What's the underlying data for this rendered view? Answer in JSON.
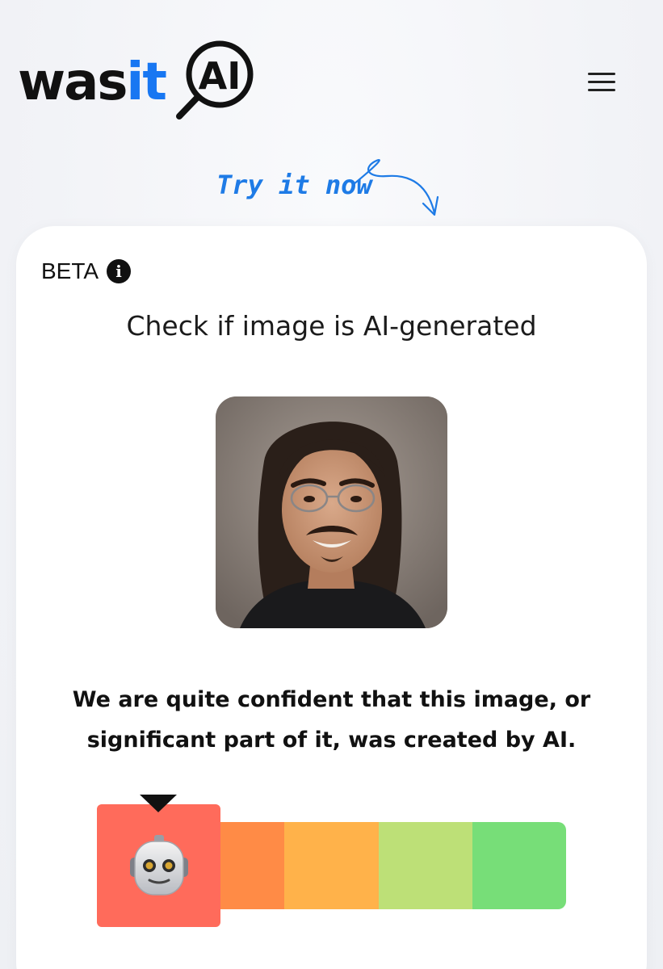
{
  "header": {
    "logo": {
      "text_main": "wasit",
      "text_accent": "AI"
    },
    "menu_icon": "hamburger-menu-icon"
  },
  "cta": {
    "try_now": "Try it now"
  },
  "card": {
    "beta_label": "BETA",
    "info_icon": "info-icon",
    "title": "Check if image is AI-generated",
    "photo_alt": "Uploaded portrait photo",
    "verdict_line1": "We are quite confident that this image, or",
    "verdict_line2": "significant part of it, was created by AI.",
    "meter": {
      "selected_index": 0,
      "selected_icon": "robot-icon",
      "segments": [
        "#ff6b5b",
        "#ff8b46",
        "#ffb24a",
        "#bde077",
        "#77de78"
      ]
    }
  },
  "colors": {
    "accent": "#1877f2",
    "cta": "#1e7be6",
    "text": "#111111"
  }
}
